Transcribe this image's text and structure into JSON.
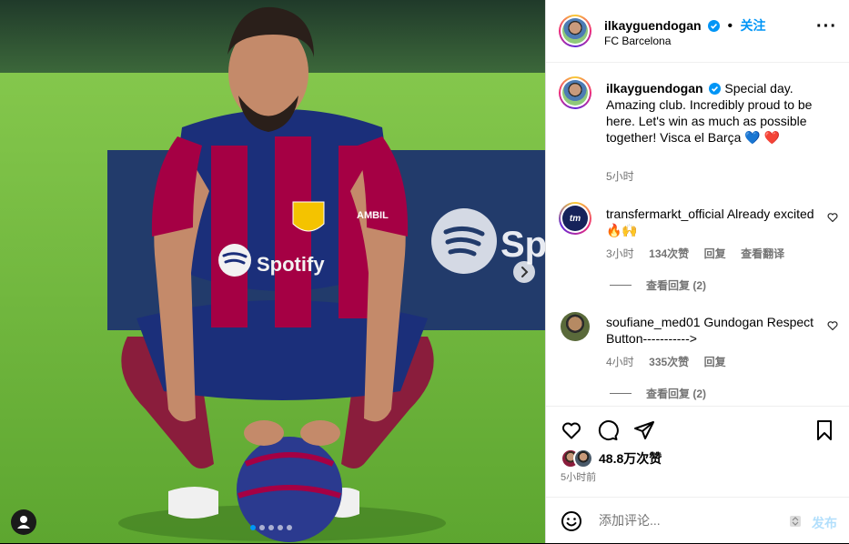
{
  "post": {
    "username": "ilkayguendogan",
    "follow_label": "关注",
    "location": "FC Barcelona",
    "caption_parts": [
      "Special day. Amazing club. Incredibly proud to be here. Let's win as much as possible together! Visca el Barça",
      "💙",
      "❤️"
    ],
    "caption_time": "5小时",
    "likes": "48.8万次赞",
    "time": "5小时前",
    "comment_placeholder": "添加评论...",
    "post_label": "发布"
  },
  "photo": {
    "jersey_sponsor": "Spotify",
    "sleeve_text": "AMBIL",
    "board_text": "Sp"
  },
  "comments": [
    {
      "username": "transfermarkt_official",
      "avatar_text": "tm",
      "text": "Already excited 🔥🙌",
      "time": "3小时",
      "likes": "134次赞",
      "reply": "回复",
      "translate": "查看翻译",
      "view_replies": "查看回复 (2)"
    },
    {
      "username": "soufiane_med01",
      "text": "Gundogan Respect Button----------->",
      "time": "4小时",
      "likes": "335次赞",
      "reply": "回复",
      "view_replies": "查看回复 (2)"
    }
  ],
  "colors": {
    "verified": "#0095f6",
    "follow": "#0095f6",
    "heart_blue": "#1da1f2",
    "heart_red": "#e0245e",
    "grass": "#6fbf3a",
    "barca_blue": "#1b2f7a",
    "barca_red": "#a50044"
  }
}
